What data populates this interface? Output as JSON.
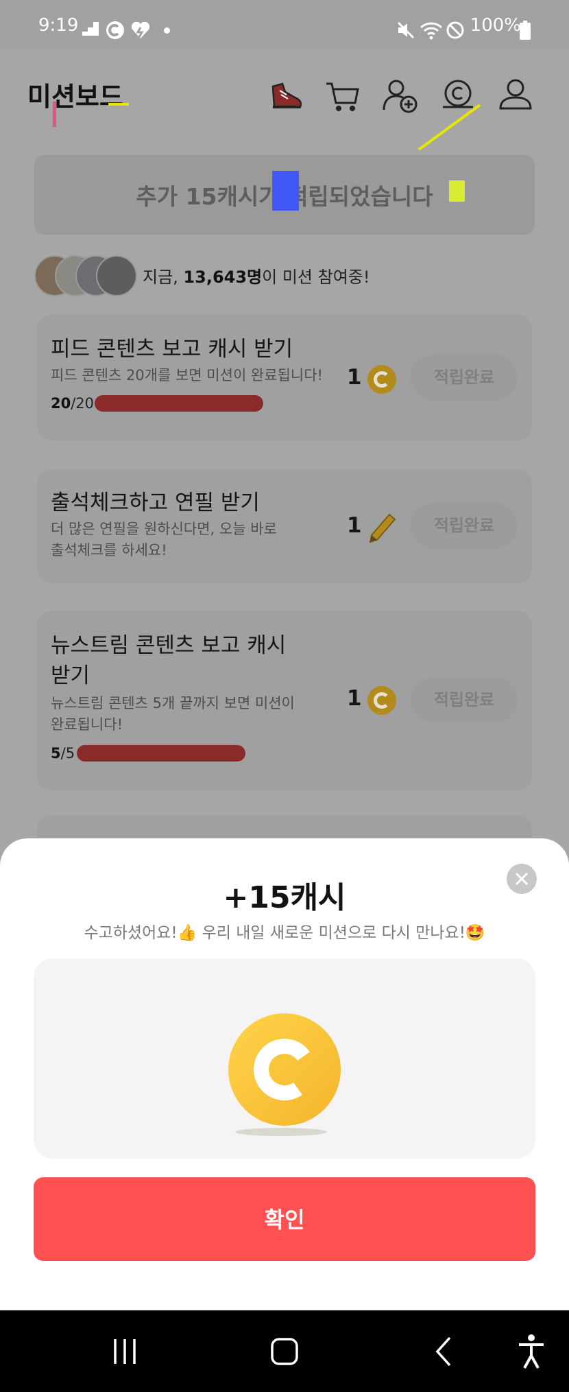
{
  "status_bar": {
    "time": "9:19",
    "battery": "100%",
    "icons": [
      "stack-icon",
      "c-notification-icon",
      "heart-notification-icon",
      "dot-icon",
      "mute-icon",
      "wifi-icon",
      "dnd-icon",
      "battery-icon"
    ]
  },
  "header": {
    "title": "미션보드",
    "icons": [
      "shoe-icon",
      "cart-icon",
      "add-friend-icon",
      "cash-coin-icon",
      "profile-icon"
    ]
  },
  "notice": {
    "text": "추가 15캐시가 적립되었습니다"
  },
  "participants": {
    "prefix": "지금, ",
    "count": "13,643명",
    "suffix": "이 미션 참여중!"
  },
  "missions": [
    {
      "title": "피드 콘텐츠 보고 캐시 받기",
      "desc": "피드 콘텐츠 20개를 보면 미션이 완료됩니다!",
      "progress_done": "20",
      "progress_total": "/20",
      "progress": 1.0,
      "reward": "1",
      "reward_icon": "coin-icon",
      "button": "적립완료"
    },
    {
      "title": "출석체크하고 연필 받기",
      "desc_line1": "더 많은 연필을 원하신다면, 오늘 바로",
      "desc_line2": "출석체크를 하세요!",
      "reward": "1",
      "reward_icon": "pencil-icon",
      "button": "적립완료"
    },
    {
      "title_line1": "뉴스트림 콘텐츠 보고 캐시",
      "title_line2": "받기",
      "desc_line1": "뉴스트림 콘텐츠 5개 끝까지 보면 미션이",
      "desc_line2": "완료됩니다!",
      "progress_done": "5",
      "progress_total": "/5",
      "progress": 1.0,
      "reward": "1",
      "reward_icon": "coin-icon",
      "button": "적립완료"
    }
  ],
  "sheet": {
    "title": "+15캐시",
    "subtitle_a": "수고하셨어요!",
    "emoji_a": "👍",
    "subtitle_b": " 우리 내일 새로운 미션으로 다시 만나요!",
    "emoji_b": "🤩",
    "confirm": "확인"
  },
  "colors": {
    "accent": "#ff5151",
    "coin": "#f4b42a",
    "progress": "#8b2a2a"
  }
}
